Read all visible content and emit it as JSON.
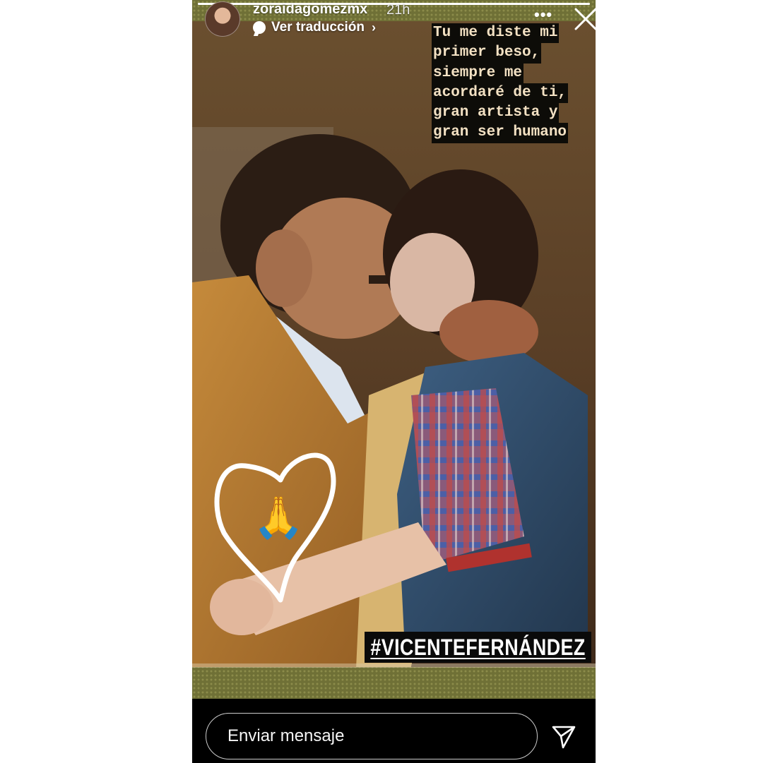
{
  "story": {
    "username": "zoraidagomezmx",
    "time": "21h",
    "translate_label": "Ver traducción",
    "more_icon": "more-icon",
    "caption_lines": [
      "Tu me diste mi",
      "primer beso,",
      "siempre me",
      "acordaré de ti,",
      "gran artista y",
      "gran ser humano"
    ],
    "hashtag": "#VICENTEFERNÁNDEZ",
    "progress": 1.0
  },
  "footer": {
    "message_placeholder": "Enviar mensaje",
    "send_icon": "send-icon"
  },
  "colors": {
    "caption_text": "#f3e1c3",
    "caption_bg": "#0d0c08",
    "story_bg": "#000000"
  }
}
